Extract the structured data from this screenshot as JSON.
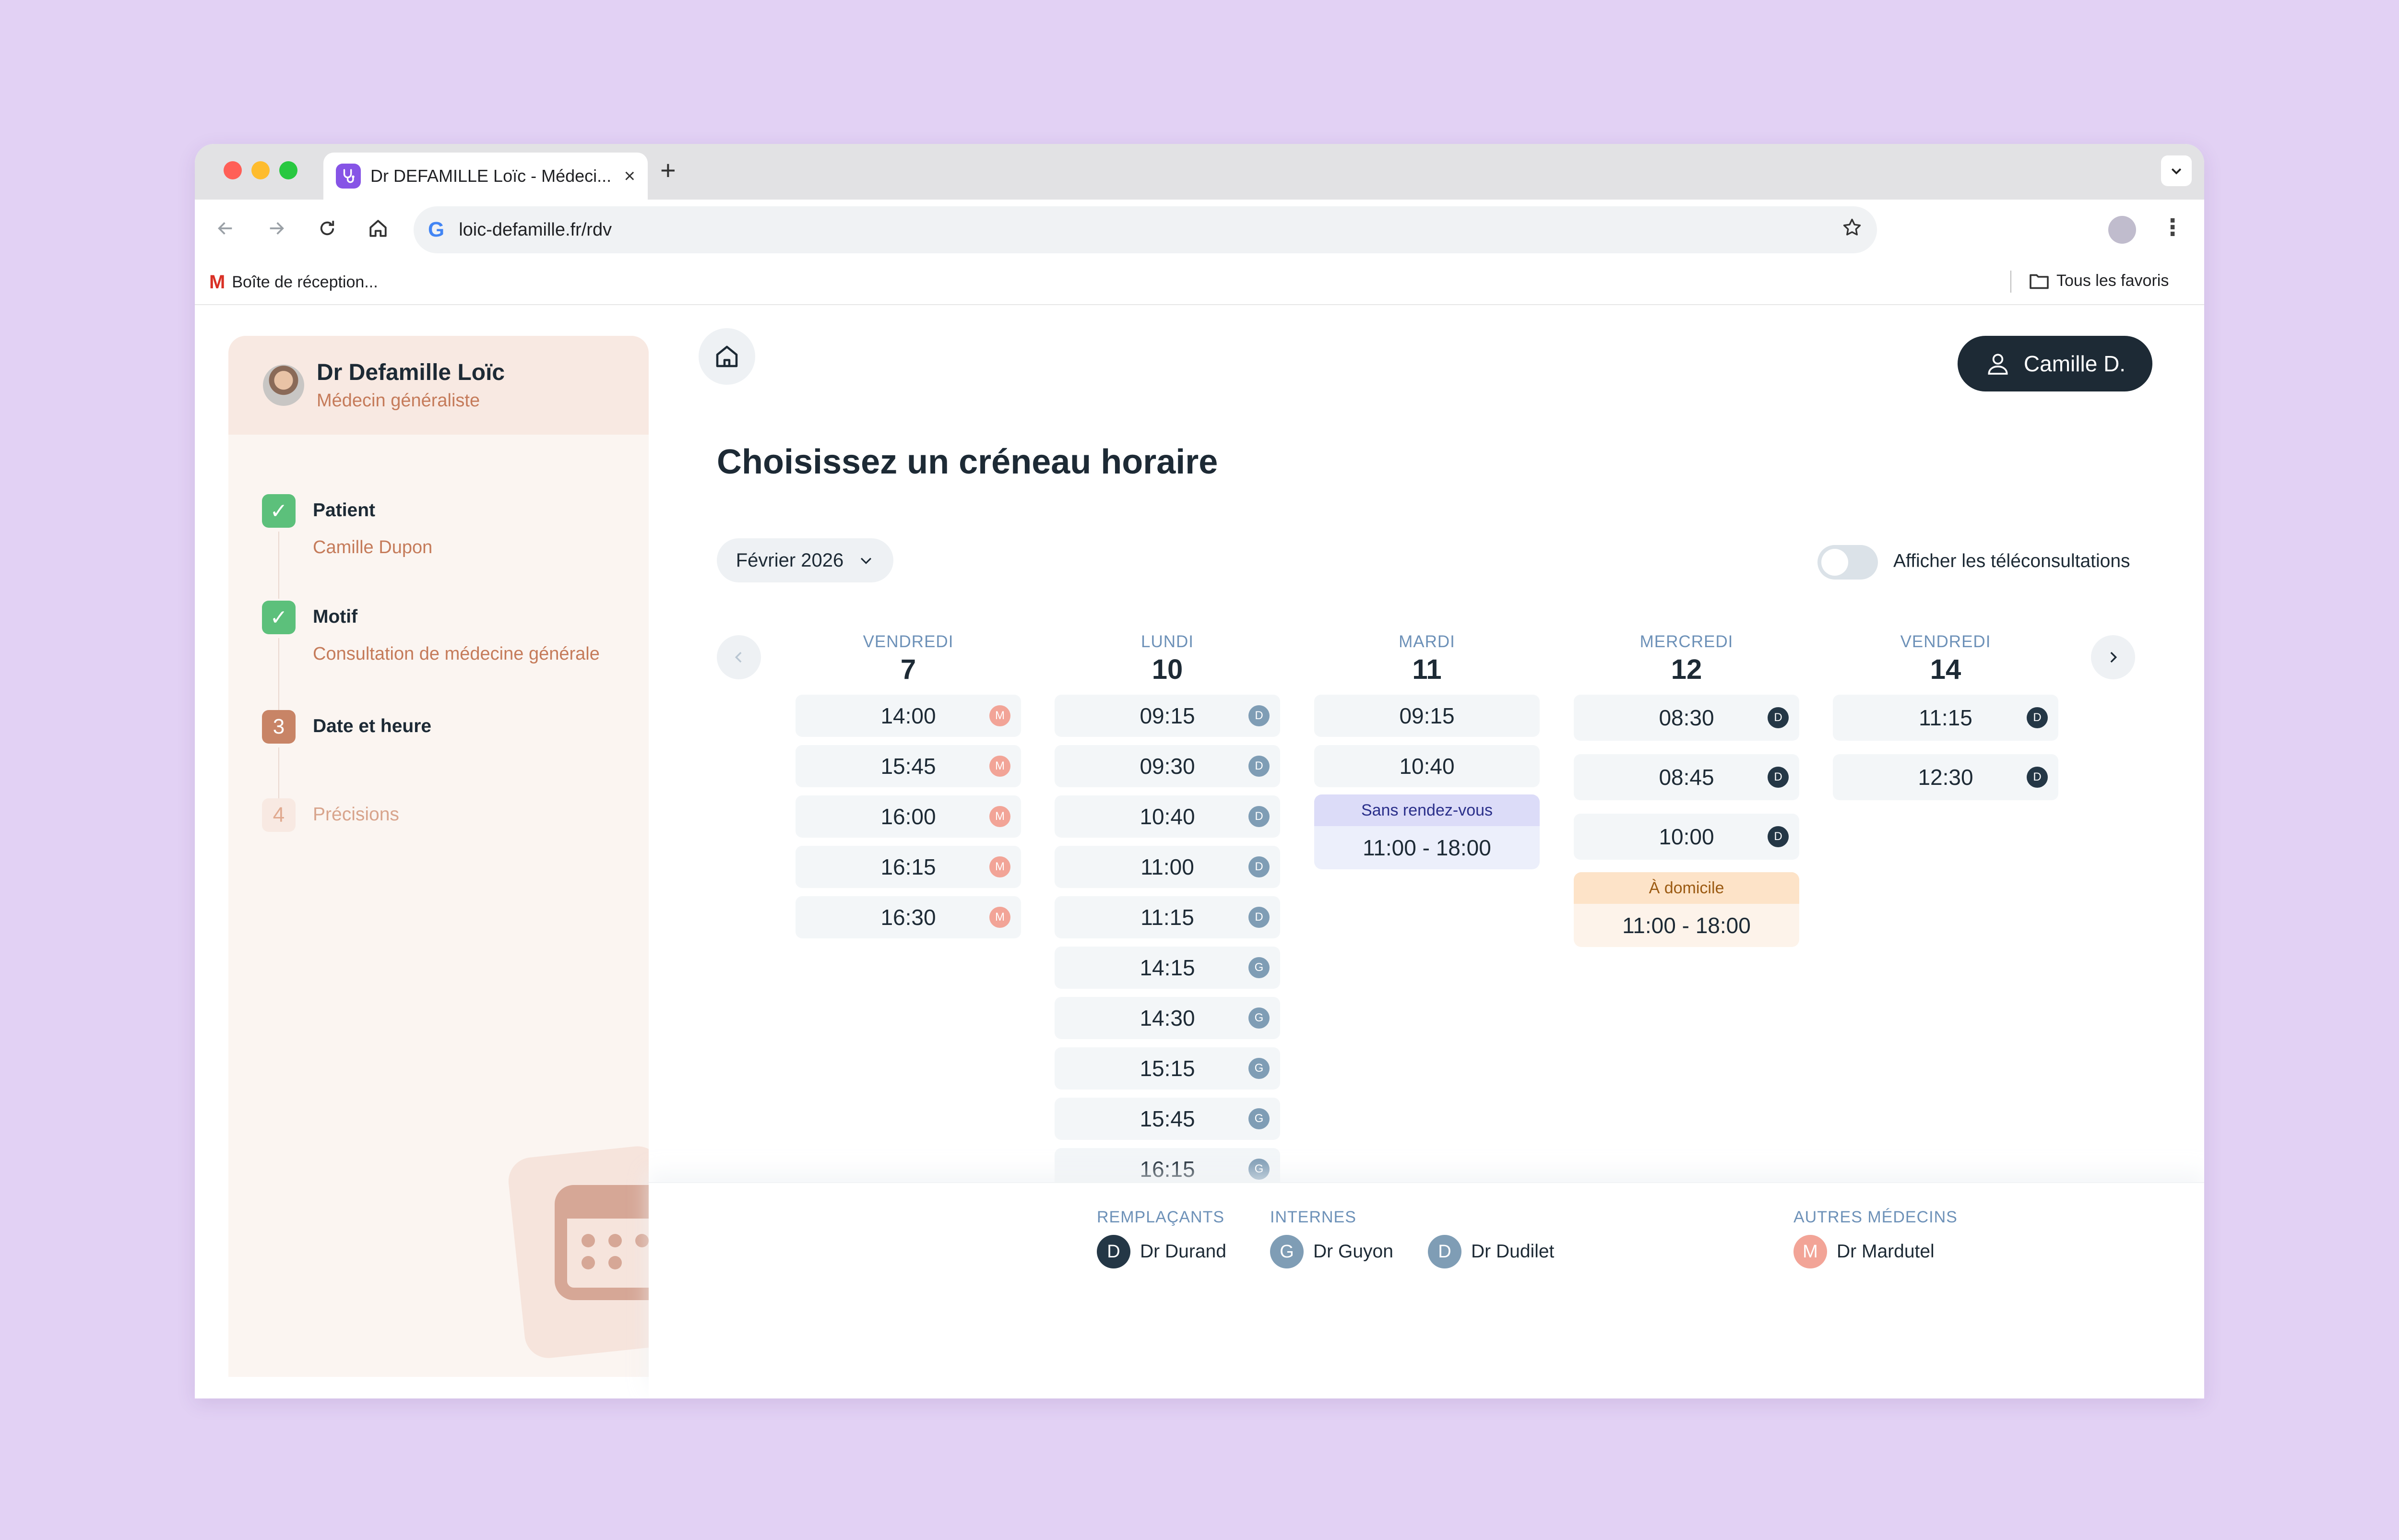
{
  "browser": {
    "tab_title": "Dr DEFAMILLE Loïc - Médeci...",
    "tab_close": "×",
    "new_tab": "+",
    "url": "loic-defamille.fr/rdv",
    "bookmark_inbox": "Boîte de réception...",
    "bookmark_all": "Tous les favoris",
    "traffic_colors": [
      "#ff5f57",
      "#febc2e",
      "#28c840"
    ]
  },
  "sidebar": {
    "doctor_name": "Dr Defamille Loïc",
    "doctor_specialty": "Médecin généraliste",
    "steps": [
      {
        "badge": "✓",
        "label": "Patient",
        "value": "Camille Dupon",
        "state": "done"
      },
      {
        "badge": "✓",
        "label": "Motif",
        "value": "Consultation de médecine générale",
        "state": "done"
      },
      {
        "badge": "3",
        "label": "Date et heure",
        "value": "",
        "state": "current"
      },
      {
        "badge": "4",
        "label": "Précisions",
        "value": "",
        "state": "todo"
      }
    ]
  },
  "header": {
    "user_label": "Camille D."
  },
  "main": {
    "title": "Choisissez un créneau horaire",
    "month": "Février 2026",
    "teleconsult_label": "Afficher les téléconsultations",
    "teleconsult_on": false
  },
  "days": [
    {
      "name": "VENDREDI",
      "num": "7",
      "slots": [
        {
          "time": "14:00",
          "doc": "M"
        },
        {
          "time": "15:45",
          "doc": "M"
        },
        {
          "time": "16:00",
          "doc": "M"
        },
        {
          "time": "16:15",
          "doc": "M"
        },
        {
          "time": "16:30",
          "doc": "M"
        }
      ]
    },
    {
      "name": "LUNDI",
      "num": "10",
      "slots": [
        {
          "time": "09:15",
          "doc": "D"
        },
        {
          "time": "09:30",
          "doc": "D"
        },
        {
          "time": "10:40",
          "doc": "D"
        },
        {
          "time": "11:00",
          "doc": "D"
        },
        {
          "time": "11:15",
          "doc": "D"
        },
        {
          "time": "14:15",
          "doc": "G"
        },
        {
          "time": "14:30",
          "doc": "G"
        },
        {
          "time": "15:15",
          "doc": "G"
        },
        {
          "time": "15:45",
          "doc": "G"
        },
        {
          "time": "16:15",
          "doc": "G"
        }
      ]
    },
    {
      "name": "MARDI",
      "num": "11",
      "slots": [
        {
          "time": "09:15",
          "doc": ""
        },
        {
          "time": "10:40",
          "doc": ""
        }
      ],
      "special": {
        "label": "Sans rendez-vous",
        "range": "11:00 - 18:00"
      }
    },
    {
      "name": "MERCREDI",
      "num": "12",
      "slots": [
        {
          "time": "08:30",
          "doc": "D"
        },
        {
          "time": "08:45",
          "doc": "D"
        },
        {
          "time": "10:00",
          "doc": "D"
        }
      ],
      "special": {
        "label": "À domicile",
        "range": "11:00 - 18:00"
      }
    },
    {
      "name": "VENDREDI",
      "num": "14",
      "slots": [
        {
          "time": "11:15",
          "doc": "D"
        },
        {
          "time": "12:30",
          "doc": "D"
        }
      ]
    }
  ],
  "legend": {
    "replacements_title": "REMPLAÇANTS",
    "interns_title": "INTERNES",
    "others_title": "AUTRES MÉDECINS",
    "people": [
      {
        "initial": "D",
        "name": "Dr Durand",
        "color": "#243746"
      },
      {
        "initial": "G",
        "name": "Dr Guyon",
        "color": "#7f9db5"
      },
      {
        "initial": "D",
        "name": "Dr Dudilet",
        "color": "#7f9db5"
      },
      {
        "initial": "M",
        "name": "Dr Mardutel",
        "color": "#f2a497"
      }
    ]
  },
  "colors": {
    "accent_dark": "#1d2a35",
    "done_green": "#5cc07b",
    "current_brown": "#c88466",
    "walkin_bg": "#dcdcf8",
    "home_visit_bg": "#fde3c8",
    "initial_D": "#243746",
    "initial_G": "#7f9db5",
    "initial_M": "#f2a497"
  }
}
